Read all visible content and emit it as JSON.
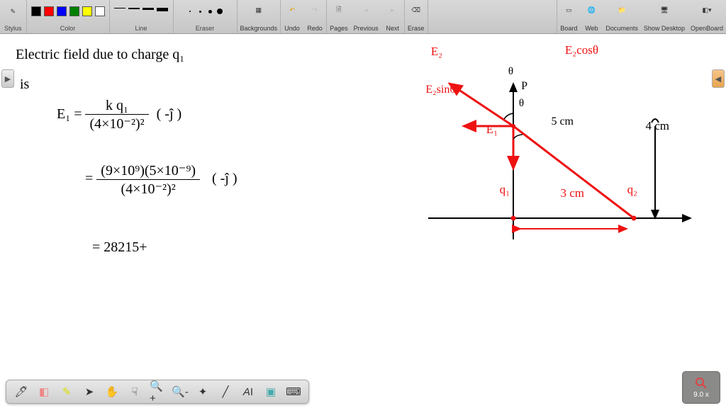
{
  "toolbar": {
    "stylus_label": "Stylus",
    "color_label": "Color",
    "colors": [
      "#000000",
      "#ff0000",
      "#0000ff",
      "#008000",
      "#ffff00",
      "#ffffff"
    ],
    "line_label": "Line",
    "line_widths": [
      1,
      2,
      3,
      5
    ],
    "dot_sizes": [
      2,
      3,
      5,
      8
    ],
    "eraser_label": "Eraser",
    "backgrounds_label": "Backgrounds",
    "undo_label": "Undo",
    "redo_label": "Redo",
    "pages_label": "Pages",
    "previous_label": "Previous",
    "next_label": "Next",
    "erase_label": "Erase",
    "board_label": "Board",
    "web_label": "Web",
    "documents_label": "Documents",
    "show_desktop_label": "Show Desktop",
    "openboard_label": "OpenBoard"
  },
  "handwriting": {
    "line1": "Electric field due to charge q₁",
    "line2": "is",
    "eq1_lhs": "E₁ =",
    "eq1_num": "k q₁",
    "eq1_den": "(4×10⁻²)²",
    "eq1_unit": "( -ĵ )",
    "eq2_eq": "=",
    "eq2_num": "(9×10⁹)(5×10⁻⁹)",
    "eq2_den": "(4×10⁻²)²",
    "eq2_unit": "( -ĵ )",
    "eq3": "= 28215+"
  },
  "diagram": {
    "e2": "E₂",
    "e2cos": "E₂cosθ",
    "e2sin": "E₂sinθ",
    "theta1": "θ",
    "theta2": "θ",
    "p": "P",
    "e1": "E₁",
    "five_cm": "5 cm",
    "four_cm": "4 cm",
    "three_cm": "3 cm",
    "q1": "q₁",
    "q2": "q₂"
  },
  "zoom": {
    "value": "9.0 x"
  },
  "bottom_tools": [
    "pen",
    "eraser",
    "highlighter",
    "pointer",
    "hand",
    "hand2",
    "zoom-in",
    "zoom-out",
    "laser",
    "line",
    "text",
    "capture",
    "keyboard"
  ],
  "side_tabs": {
    "left": "▶",
    "right": "◀"
  }
}
